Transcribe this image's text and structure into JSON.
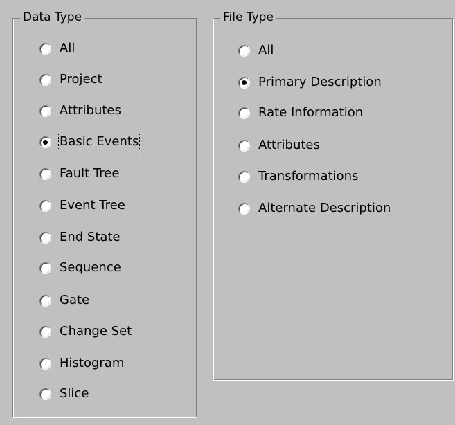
{
  "data_type": {
    "title": "Data Type",
    "selected": "Basic Events",
    "options": [
      {
        "label": "All",
        "checked": false
      },
      {
        "label": "Project",
        "checked": false
      },
      {
        "label": "Attributes",
        "checked": false
      },
      {
        "label": "Basic Events",
        "checked": true,
        "focused": true
      },
      {
        "label": "Fault Tree",
        "checked": false
      },
      {
        "label": "Event Tree",
        "checked": false
      },
      {
        "label": "End State",
        "checked": false
      },
      {
        "label": "Sequence",
        "checked": false
      },
      {
        "label": "Gate",
        "checked": false
      },
      {
        "label": "Change Set",
        "checked": false
      },
      {
        "label": "Histogram",
        "checked": false
      },
      {
        "label": "Slice",
        "checked": false
      }
    ]
  },
  "file_type": {
    "title": "File Type",
    "selected": "Primary Description",
    "options": [
      {
        "label": "All",
        "checked": false
      },
      {
        "label": "Primary Description",
        "checked": true
      },
      {
        "label": "Rate Information",
        "checked": false
      },
      {
        "label": "Attributes",
        "checked": false
      },
      {
        "label": "Transformations",
        "checked": false
      },
      {
        "label": "Alternate Description",
        "checked": false
      }
    ]
  },
  "colors": {
    "face": "#c0c0c0",
    "shadow": "#808080",
    "highlight": "#ffffff",
    "text": "#000000"
  }
}
